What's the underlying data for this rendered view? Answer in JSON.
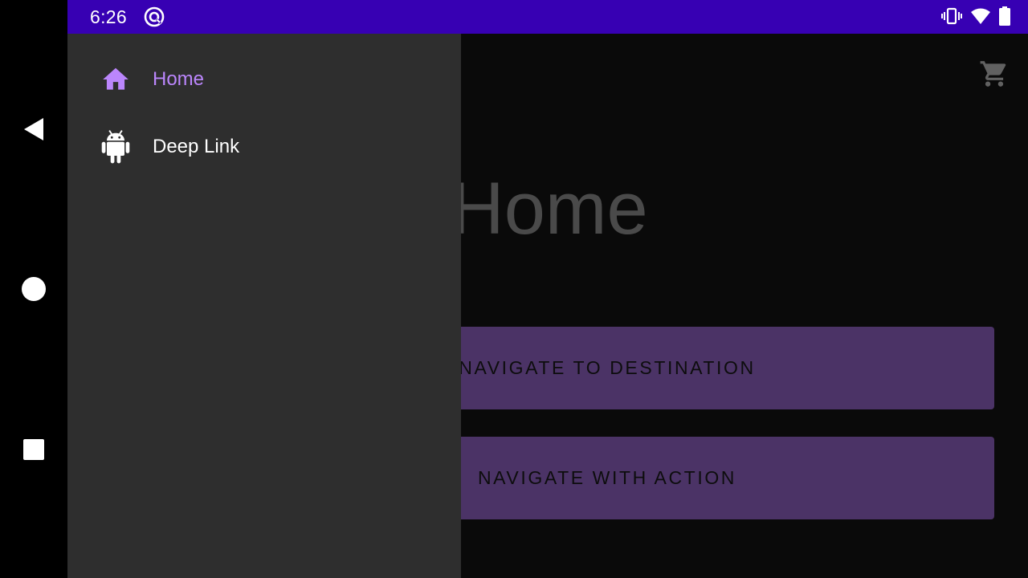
{
  "status_bar": {
    "time": "6:26",
    "app_icon": "at-sign-icon",
    "icons": [
      "vibrate-icon",
      "wifi-icon",
      "battery-icon"
    ],
    "background": "#3700b3"
  },
  "nav_bar": {
    "buttons": [
      "back-icon",
      "home-circle-icon",
      "recents-square-icon"
    ]
  },
  "drawer": {
    "items": [
      {
        "label": "Home",
        "icon": "home-icon",
        "selected": true,
        "color": "#bb86fc"
      },
      {
        "label": "Deep Link",
        "icon": "android-icon",
        "selected": false,
        "color": "#ffffff"
      }
    ],
    "background": "#2e2e2e"
  },
  "app": {
    "toolbar_icon": "cart-icon",
    "title": "Home",
    "buttons": {
      "navigate_destination": "NAVIGATE TO DESTINATION",
      "navigate_action": "NAVIGATE WITH ACTION"
    },
    "button_color": "#4b3366"
  }
}
